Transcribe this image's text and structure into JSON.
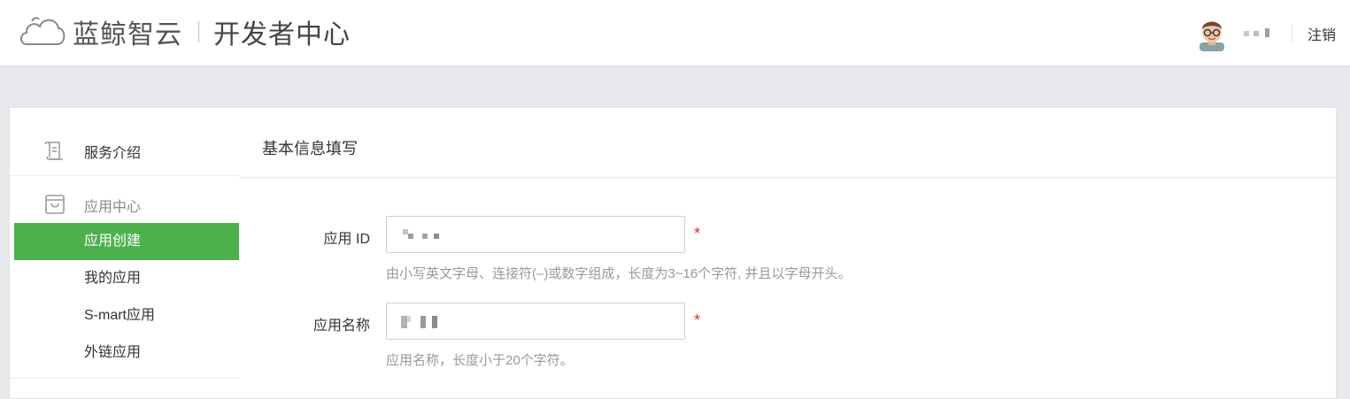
{
  "header": {
    "brand_name": "蓝鲸智云",
    "brand_sub": "开发者中心",
    "logout_label": "注销"
  },
  "sidebar": {
    "service_intro": "服务介绍",
    "group_title": "应用中心",
    "items": [
      {
        "label": "应用创建",
        "active": true
      },
      {
        "label": "我的应用",
        "active": false
      },
      {
        "label": "S-mart应用",
        "active": false
      },
      {
        "label": "外链应用",
        "active": false
      }
    ]
  },
  "main": {
    "section_title": "基本信息填写",
    "fields": [
      {
        "label": "应用 ID",
        "required_mark": "*",
        "hint": "由小写英文字母、连接符(–)或数字组成，长度为3~16个字符, 并且以字母开头。"
      },
      {
        "label": "应用名称",
        "required_mark": "*",
        "hint": "应用名称，长度小于20个字符。"
      }
    ]
  },
  "colors": {
    "accent": "#4cb14c",
    "required": "#e02b2b",
    "background": "#e7e8eb"
  }
}
